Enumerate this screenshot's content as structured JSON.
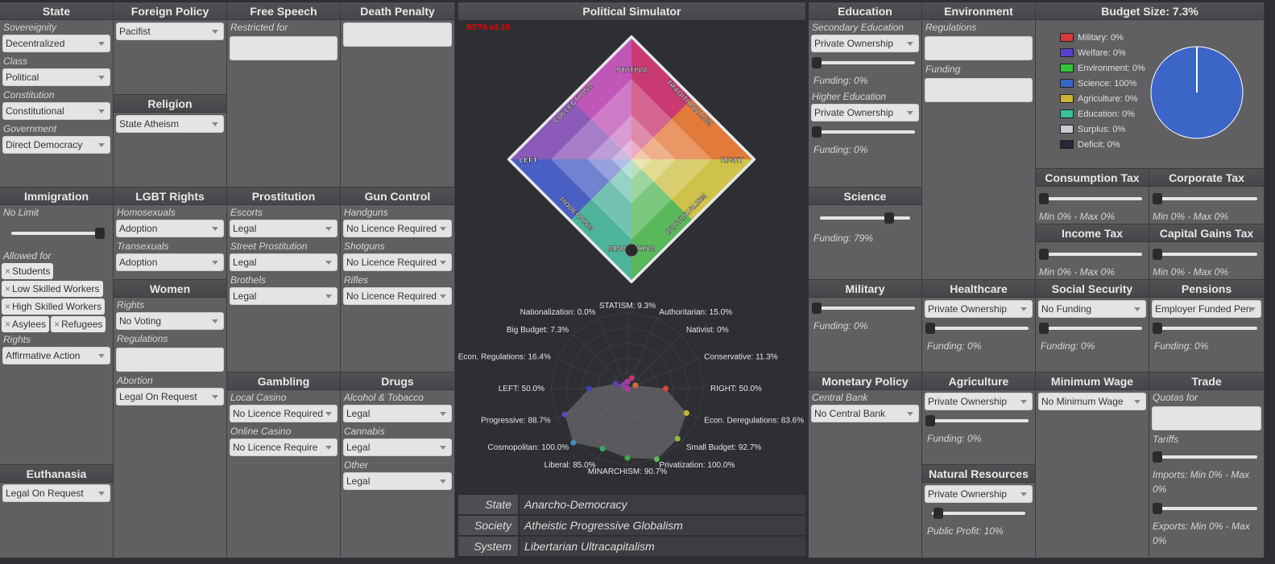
{
  "state": {
    "title": "State",
    "sovereignty_label": "Sovereignity",
    "sovereignty": "Decentralized",
    "class_label": "Class",
    "class": "Political",
    "constitution_label": "Constitution",
    "constitution": "Constitutional",
    "government_label": "Government",
    "government": "Direct Democracy"
  },
  "foreign_policy": {
    "title": "Foreign Policy",
    "value": "Pacifist"
  },
  "religion": {
    "title": "Religion",
    "value": "State Atheism"
  },
  "free_speech": {
    "title": "Free Speech",
    "restricted_label": "Restricted for"
  },
  "death_penalty": {
    "title": "Death Penalty"
  },
  "immigration": {
    "title": "Immigration",
    "no_limit": "No Limit",
    "allowed_label": "Allowed for",
    "allowed": [
      "Students",
      "Low Skilled Workers",
      "High Skilled Workers",
      "Asylees",
      "Refugees"
    ],
    "rights_label": "Rights",
    "rights": "Affirmative Action"
  },
  "lgbt": {
    "title": "LGBT Rights",
    "homosexuals_label": "Homosexuals",
    "homosexuals": "Adoption",
    "transexuals_label": "Transexuals",
    "transexuals": "Adoption"
  },
  "women": {
    "title": "Women",
    "rights_label": "Rights",
    "rights": "No Voting",
    "regulations_label": "Regulations",
    "abortion_label": "Abortion",
    "abortion": "Legal On Request"
  },
  "euthanasia": {
    "title": "Euthanasia",
    "value": "Legal On Request"
  },
  "prostitution": {
    "title": "Prostitution",
    "escorts_label": "Escorts",
    "escorts": "Legal",
    "street_label": "Street Prostitution",
    "street": "Legal",
    "brothels_label": "Brothels",
    "brothels": "Legal"
  },
  "gun_control": {
    "title": "Gun Control",
    "handguns_label": "Handguns",
    "handguns": "No Licence Required",
    "shotguns_label": "Shotguns",
    "shotguns": "No Licence Required",
    "rifles_label": "Rifles",
    "rifles": "No Licence Required"
  },
  "gambling": {
    "title": "Gambling",
    "local_label": "Local Casino",
    "local": "No Licence Required",
    "online_label": "Online Casino",
    "online": "No Licence Require"
  },
  "drugs": {
    "title": "Drugs",
    "alcohol_label": "Alcohol & Tobacco",
    "alcohol": "Legal",
    "cannabis_label": "Cannabis",
    "cannabis": "Legal",
    "other_label": "Other",
    "other": "Legal"
  },
  "simulator": {
    "title": "Political Simulator",
    "beta": "BETA v3.10",
    "diamond_labels": {
      "statism": "STATISM",
      "traditionalism": "TRADITIONALISM",
      "right": "RIGHT",
      "individualism": "INDIVIDUALISM",
      "minarchism": "MINARCHISM",
      "modernism": "MODERNISM",
      "left": "LEFT",
      "collectivism": "COLLECTIVISM"
    },
    "radar": [
      {
        "label": "STATISM: 9.3%",
        "value": 9.3
      },
      {
        "label": "Authoritarian: 15.0%",
        "value": 15.0
      },
      {
        "label": "Nativist: 0%",
        "value": 0
      },
      {
        "label": "Conservative: 11.3%",
        "value": 11.3
      },
      {
        "label": "RIGHT: 50.0%",
        "value": 50.0
      },
      {
        "label": "Econ. Deregulations: 83.6%",
        "value": 83.6
      },
      {
        "label": "Small Budget: 92.7%",
        "value": 92.7
      },
      {
        "label": "Privatization: 100.0%",
        "value": 100.0
      },
      {
        "label": "MINARCHISM: 90.7%",
        "value": 90.7
      },
      {
        "label": "Liberal: 85.0%",
        "value": 85.0
      },
      {
        "label": "Cosmopolitan: 100.0%",
        "value": 100.0
      },
      {
        "label": "Progressive: 88.7%",
        "value": 88.7
      },
      {
        "label": "LEFT: 50.0%",
        "value": 50.0
      },
      {
        "label": "Econ. Regulations: 16.4%",
        "value": 16.4
      },
      {
        "label": "Big Budget: 7.3%",
        "value": 7.3
      },
      {
        "label": "Nationalization: 0.0%",
        "value": 0.0
      }
    ],
    "results": [
      {
        "key": "State",
        "value": "Anarcho-Democracy"
      },
      {
        "key": "Society",
        "value": "Atheistic Progressive Globalism"
      },
      {
        "key": "System",
        "value": "Libertarian Ultracapitalism"
      }
    ]
  },
  "education": {
    "title": "Education",
    "secondary_label": "Secondary Education",
    "secondary": "Private Ownership",
    "secondary_funding": "Funding: 0%",
    "higher_label": "Higher Education",
    "higher": "Private Ownership",
    "higher_funding": "Funding: 0%"
  },
  "environment": {
    "title": "Environment",
    "regulations_label": "Regulations",
    "funding_label": "Funding"
  },
  "budget": {
    "title": "Budget Size: 7.3%",
    "items": [
      {
        "label": "Military: 0%",
        "color": "#d9383a"
      },
      {
        "label": "Welfare: 0%",
        "color": "#5a3ed0"
      },
      {
        "label": "Environment: 0%",
        "color": "#35c43a"
      },
      {
        "label": "Science: 100%",
        "color": "#3b65c6"
      },
      {
        "label": "Agriculture: 0%",
        "color": "#c9b531"
      },
      {
        "label": "Education: 0%",
        "color": "#35c49a"
      },
      {
        "label": "Surplus: 0%",
        "color": "#c8cad2"
      },
      {
        "label": "Deficit: 0%",
        "color": "#23283a"
      }
    ],
    "pie_color": "#3b65c6"
  },
  "science": {
    "title": "Science",
    "funding": "Funding: 79%",
    "level": 0.79
  },
  "consumption_tax": {
    "title": "Consumption Tax",
    "range": "Min 0% - Max 0%"
  },
  "corporate_tax": {
    "title": "Corporate Tax",
    "range": "Min 0% - Max 0%"
  },
  "income_tax": {
    "title": "Income Tax",
    "range": "Min 0% - Max 0%"
  },
  "capital_gains_tax": {
    "title": "Capital Gains Tax",
    "range": "Min 0% - Max 0%"
  },
  "military": {
    "title": "Military",
    "funding": "Funding: 0%"
  },
  "healthcare": {
    "title": "Healthcare",
    "value": "Private Ownership",
    "funding": "Funding: 0%"
  },
  "social_security": {
    "title": "Social Security",
    "value": "No Funding",
    "funding": "Funding: 0%"
  },
  "pensions": {
    "title": "Pensions",
    "value": "Employer Funded Pen",
    "funding": "Funding: 0%"
  },
  "monetary_policy": {
    "title": "Monetary Policy",
    "central_bank_label": "Central Bank",
    "central_bank": "No Central Bank"
  },
  "agriculture": {
    "title": "Agriculture",
    "value": "Private Ownership",
    "funding": "Funding: 0%"
  },
  "natural_resources": {
    "title": "Natural Resources",
    "value": "Private Ownership",
    "profit": "Public Profit: 10%"
  },
  "minimum_wage": {
    "title": "Minimum Wage",
    "value": "No Minimum Wage"
  },
  "trade": {
    "title": "Trade",
    "quotas_label": "Quotas for",
    "tariffs_label": "Tariffs",
    "imports": "Imports: Min 0% - Max 0%",
    "exports": "Exports: Min 0% - Max 0%"
  }
}
